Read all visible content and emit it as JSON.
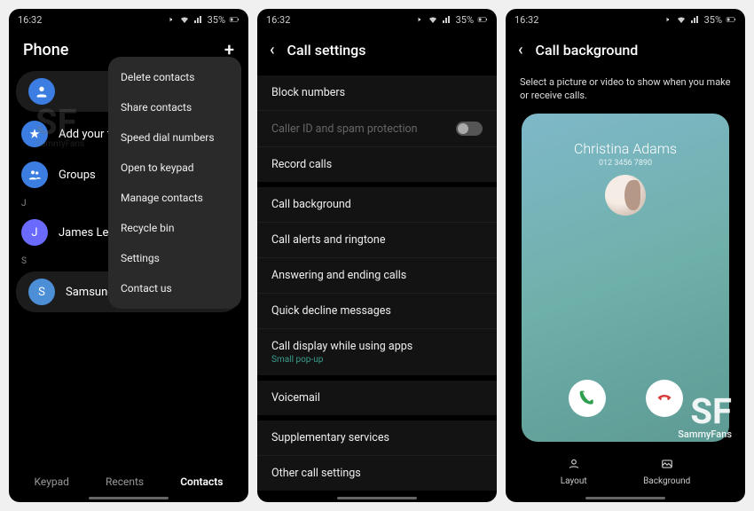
{
  "status": {
    "time": "16:32",
    "battery": "35%"
  },
  "watermark": {
    "sf": "SF",
    "fans": "SammyFans"
  },
  "screen1": {
    "title": "Phone",
    "rows": {
      "profile": "",
      "favourites": "Add your favourites",
      "groups": "Groups",
      "james": "James Lee Tay...",
      "james_initial": "J",
      "samsung": "Samsung Helpline",
      "samsung_initial": "S"
    },
    "letters": {
      "j": "J",
      "s": "S"
    },
    "tabs": {
      "keypad": "Keypad",
      "recents": "Recents",
      "contacts": "Contacts"
    },
    "menu": [
      "Delete contacts",
      "Share contacts",
      "Speed dial numbers",
      "Open to keypad",
      "Manage contacts",
      "Recycle bin",
      "Settings",
      "Contact us"
    ]
  },
  "screen2": {
    "title": "Call settings",
    "section1": {
      "block": "Block numbers",
      "caller_id": "Caller ID and spam protection",
      "record": "Record calls"
    },
    "section2": {
      "background": "Call background",
      "alerts": "Call alerts and ringtone",
      "answering": "Answering and ending calls",
      "decline": "Quick decline messages",
      "display": "Call display while using apps",
      "display_sub": "Small pop-up"
    },
    "section3": {
      "voicemail": "Voicemail"
    },
    "section4": {
      "supplementary": "Supplementary services",
      "other": "Other call settings"
    }
  },
  "screen3": {
    "title": "Call background",
    "desc": "Select a picture or video to show when you make or receive calls.",
    "caller_name": "Christina Adams",
    "caller_num": "012 3456 7890",
    "bottom": {
      "layout": "Layout",
      "background": "Background"
    }
  }
}
